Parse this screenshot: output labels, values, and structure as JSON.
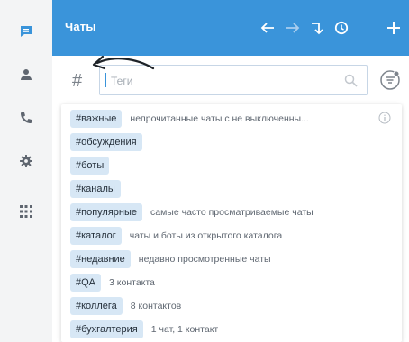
{
  "header": {
    "title": "Чаты"
  },
  "search": {
    "hash_symbol": "#",
    "placeholder": "Теги"
  },
  "tags": [
    {
      "tag": "#важные",
      "desc": "непрочитанные чаты с не выключенны..."
    },
    {
      "tag": "#обсуждения",
      "desc": ""
    },
    {
      "tag": "#боты",
      "desc": ""
    },
    {
      "tag": "#каналы",
      "desc": ""
    },
    {
      "tag": "#популярные",
      "desc": "самые часто просматриваемые чаты"
    },
    {
      "tag": "#каталог",
      "desc": "чаты и боты из открытого каталога"
    },
    {
      "tag": "#недавние",
      "desc": "недавно просмотренные чаты"
    },
    {
      "tag": "#QA",
      "desc": "3 контакта"
    },
    {
      "tag": "#коллега",
      "desc": "8 контактов"
    },
    {
      "tag": "#бухгалтерия",
      "desc": "1 чат, 1 контакт"
    }
  ],
  "colors": {
    "header_bg": "#3a94da",
    "chip_bg": "#d7e7f5",
    "rail_bg": "#f3f4f5",
    "accent": "#3a94da"
  },
  "icons": {
    "rail": [
      "chat-icon",
      "contacts-icon",
      "phone-icon",
      "settings-icon",
      "apps-grid-icon"
    ],
    "header": [
      "back-arrow-icon",
      "forward-arrow-icon",
      "move-icon",
      "history-icon",
      "plus-icon"
    ]
  }
}
